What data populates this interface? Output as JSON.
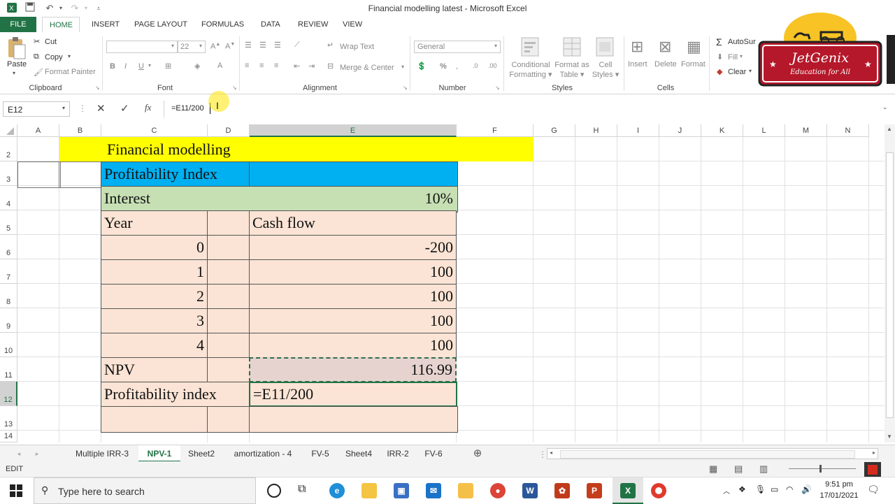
{
  "window": {
    "title": "Financial modelling latest - Microsoft Excel"
  },
  "ribbon_tabs": [
    "FILE",
    "HOME",
    "INSERT",
    "PAGE LAYOUT",
    "FORMULAS",
    "DATA",
    "REVIEW",
    "VIEW"
  ],
  "active_ribbon_tab": "HOME",
  "ribbon": {
    "clipboard": {
      "paste": "Paste",
      "cut": "Cut",
      "copy": "Copy",
      "format_painter": "Format Painter",
      "label": "Clipboard"
    },
    "font": {
      "size": "22",
      "label": "Font"
    },
    "alignment": {
      "wrap_text": "Wrap Text",
      "merge_center": "Merge & Center",
      "label": "Alignment"
    },
    "number": {
      "format": "General",
      "label": "Number"
    },
    "styles": {
      "conditional_1": "Conditional",
      "conditional_2": "Formatting",
      "format_as_1": "Format as",
      "format_as_2": "Table",
      "cell_styles_1": "Cell",
      "cell_styles_2": "Styles",
      "label": "Styles"
    },
    "cells": {
      "insert": "Insert",
      "delete": "Delete",
      "format": "Format",
      "label": "Cells"
    },
    "editing": {
      "autosum": "AutoSur",
      "fill": "Fill",
      "clear": "Clear"
    }
  },
  "logo": {
    "name": "JetGenix",
    "tagline": "Education for All"
  },
  "formula_bar": {
    "name_box": "E12",
    "formula": "=E11/200"
  },
  "columns": [
    "A",
    "B",
    "C",
    "D",
    "E",
    "F",
    "G",
    "H",
    "I",
    "J",
    "K",
    "L",
    "M",
    "N"
  ],
  "rows": [
    "2",
    "3",
    "4",
    "5",
    "6",
    "7",
    "8",
    "9",
    "10",
    "11",
    "12",
    "13",
    "14"
  ],
  "sheet": {
    "title": "Financial modelling",
    "section": "Profitability Index",
    "interest_label": "Interest",
    "interest_value": "10%",
    "year_header": "Year",
    "cashflow_header": "Cash flow",
    "years": [
      "0",
      "1",
      "2",
      "3",
      "4"
    ],
    "cashflows": [
      "-200",
      "100",
      "100",
      "100",
      "100"
    ],
    "npv_label": "NPV",
    "npv_value": "116.99",
    "pi_label": "Profitability index",
    "pi_edit": "=E11/200"
  },
  "sheet_tabs": [
    "Multiple IRR-3",
    "NPV-1",
    "Sheet2",
    "amortization - 4",
    "FV-5",
    "Sheet4",
    "IRR-2",
    "FV-6"
  ],
  "active_sheet": "NPV-1",
  "status": {
    "mode": "EDIT"
  },
  "taskbar": {
    "search_placeholder": "Type here to search",
    "time": "9:51 pm",
    "date": "17/01/2021"
  },
  "colors": {
    "excel_green": "#217346",
    "yellow": "#ffff00",
    "blue": "#00b0f0",
    "green_fill": "#c6e0b4",
    "peach": "#fbe4d5"
  }
}
